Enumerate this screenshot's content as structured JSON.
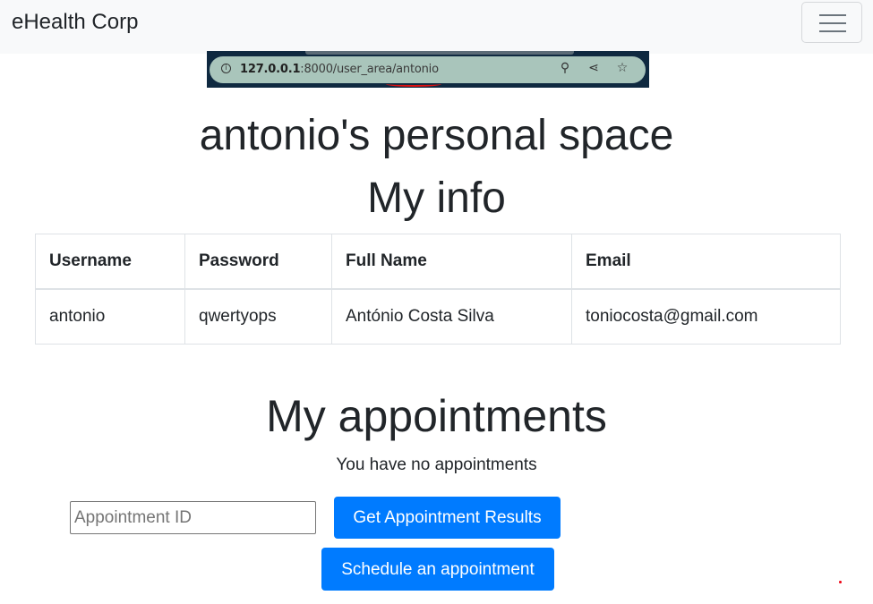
{
  "navbar": {
    "brand": "eHealth Corp",
    "toggler_icon": "hamburger-menu-icon"
  },
  "screenshot": {
    "url_host": "127.0.0.1",
    "url_rest": ":8000/user_area/antonio",
    "icons": [
      "info-icon",
      "zoom-icon",
      "share-icon",
      "star-icon"
    ],
    "highlight_color": "#dd1111"
  },
  "page": {
    "title": "antonio's personal space",
    "info_heading": "My info",
    "appointments_heading": "My appointments",
    "no_appointments": "You have no appointments"
  },
  "info_table": {
    "headers": [
      "Username",
      "Password",
      "Full Name",
      "Email"
    ],
    "rows": [
      [
        "antonio",
        "qwertyops",
        "António Costa Silva",
        "toniocosta@gmail.com"
      ]
    ]
  },
  "form": {
    "appointment_id_placeholder": "Appointment ID",
    "get_results_label": "Get Appointment Results",
    "schedule_label": "Schedule an appointment"
  },
  "colors": {
    "primary": "#007bff",
    "navbar_bg": "#f8f9fa"
  }
}
